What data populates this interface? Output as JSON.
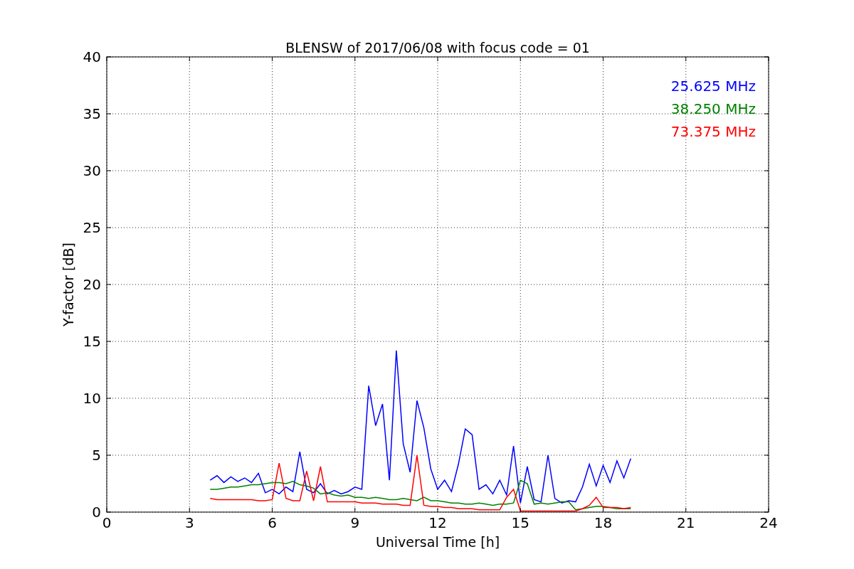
{
  "chart": {
    "chart_data": {
      "type": "line",
      "title": "BLENSW of 2017/06/08 with focus code = 01",
      "xlabel": "Universal Time [h]",
      "ylabel": "Y-factor [dB]",
      "x": [
        3.75,
        4,
        4.25,
        4.5,
        4.75,
        5,
        5.25,
        5.5,
        5.75,
        6,
        6.25,
        6.5,
        6.75,
        7,
        7.25,
        7.5,
        7.75,
        8,
        8.25,
        8.5,
        8.75,
        9,
        9.25,
        9.5,
        9.75,
        10,
        10.25,
        10.5,
        10.75,
        11,
        11.25,
        11.5,
        11.75,
        12,
        12.25,
        12.5,
        12.75,
        13,
        13.25,
        13.5,
        13.75,
        14,
        14.25,
        14.5,
        14.75,
        15,
        15.25,
        15.5,
        15.75,
        16,
        16.25,
        16.5,
        16.75,
        17,
        17.25,
        17.5,
        17.75,
        18,
        18.25,
        18.5,
        18.75,
        19
      ],
      "series": [
        {
          "name": "25.625 MHz",
          "color": "#0000ff",
          "values": [
            2.8,
            3.2,
            2.6,
            3.1,
            2.7,
            3.0,
            2.6,
            3.4,
            1.7,
            2.0,
            1.6,
            2.2,
            1.8,
            5.3,
            2.0,
            1.7,
            2.5,
            1.6,
            1.9,
            1.6,
            1.8,
            2.2,
            2.0,
            11.1,
            7.6,
            9.5,
            2.8,
            14.2,
            6.0,
            3.5,
            9.8,
            7.4,
            3.8,
            2.0,
            2.8,
            1.8,
            4.2,
            7.3,
            6.8,
            2.0,
            2.4,
            1.6,
            2.8,
            1.5,
            5.8,
            0.8,
            4.0,
            1.1,
            0.9,
            5.0,
            1.2,
            0.8,
            1.0,
            0.9,
            2.2,
            4.2,
            2.3,
            4.1,
            2.6,
            4.5,
            3.0,
            4.7
          ]
        },
        {
          "name": "38.250 MHz",
          "color": "#008000",
          "values": [
            2.0,
            2.0,
            2.1,
            2.2,
            2.2,
            2.3,
            2.4,
            2.4,
            2.5,
            2.6,
            2.6,
            2.5,
            2.7,
            2.4,
            2.3,
            2.1,
            1.6,
            1.7,
            1.5,
            1.4,
            1.5,
            1.3,
            1.3,
            1.2,
            1.3,
            1.2,
            1.1,
            1.1,
            1.2,
            1.1,
            1.0,
            1.3,
            1.0,
            1.0,
            0.9,
            0.8,
            0.8,
            0.7,
            0.7,
            0.8,
            0.7,
            0.6,
            0.7,
            0.7,
            0.8,
            2.8,
            2.5,
            0.7,
            0.8,
            0.7,
            0.8,
            0.9,
            0.9,
            0.2,
            0.3,
            0.4,
            0.5,
            0.5,
            0.4,
            0.3,
            0.3,
            0.3
          ]
        },
        {
          "name": "73.375 MHz",
          "color": "#ff0000",
          "values": [
            1.2,
            1.1,
            1.1,
            1.1,
            1.1,
            1.1,
            1.1,
            1.0,
            1.0,
            1.1,
            4.3,
            1.2,
            1.0,
            1.0,
            3.6,
            1.0,
            4.0,
            0.9,
            0.9,
            0.9,
            0.9,
            0.9,
            0.8,
            0.8,
            0.8,
            0.7,
            0.7,
            0.7,
            0.6,
            0.6,
            5.0,
            0.6,
            0.5,
            0.5,
            0.4,
            0.4,
            0.3,
            0.3,
            0.3,
            0.2,
            0.2,
            0.2,
            0.2,
            1.3,
            2.0,
            0.1,
            0.1,
            0.1,
            0.1,
            0.1,
            0.1,
            0.1,
            0.1,
            0.1,
            0.3,
            0.6,
            1.3,
            0.4,
            0.4,
            0.4,
            0.3,
            0.4
          ]
        }
      ],
      "grid": true,
      "xlim": [
        0,
        24
      ],
      "ylim": [
        0,
        40
      ],
      "xticks": [
        0,
        3,
        6,
        9,
        12,
        15,
        18,
        21,
        24
      ],
      "yticks": [
        0,
        5,
        10,
        15,
        20,
        25,
        30,
        35,
        40
      ]
    }
  }
}
